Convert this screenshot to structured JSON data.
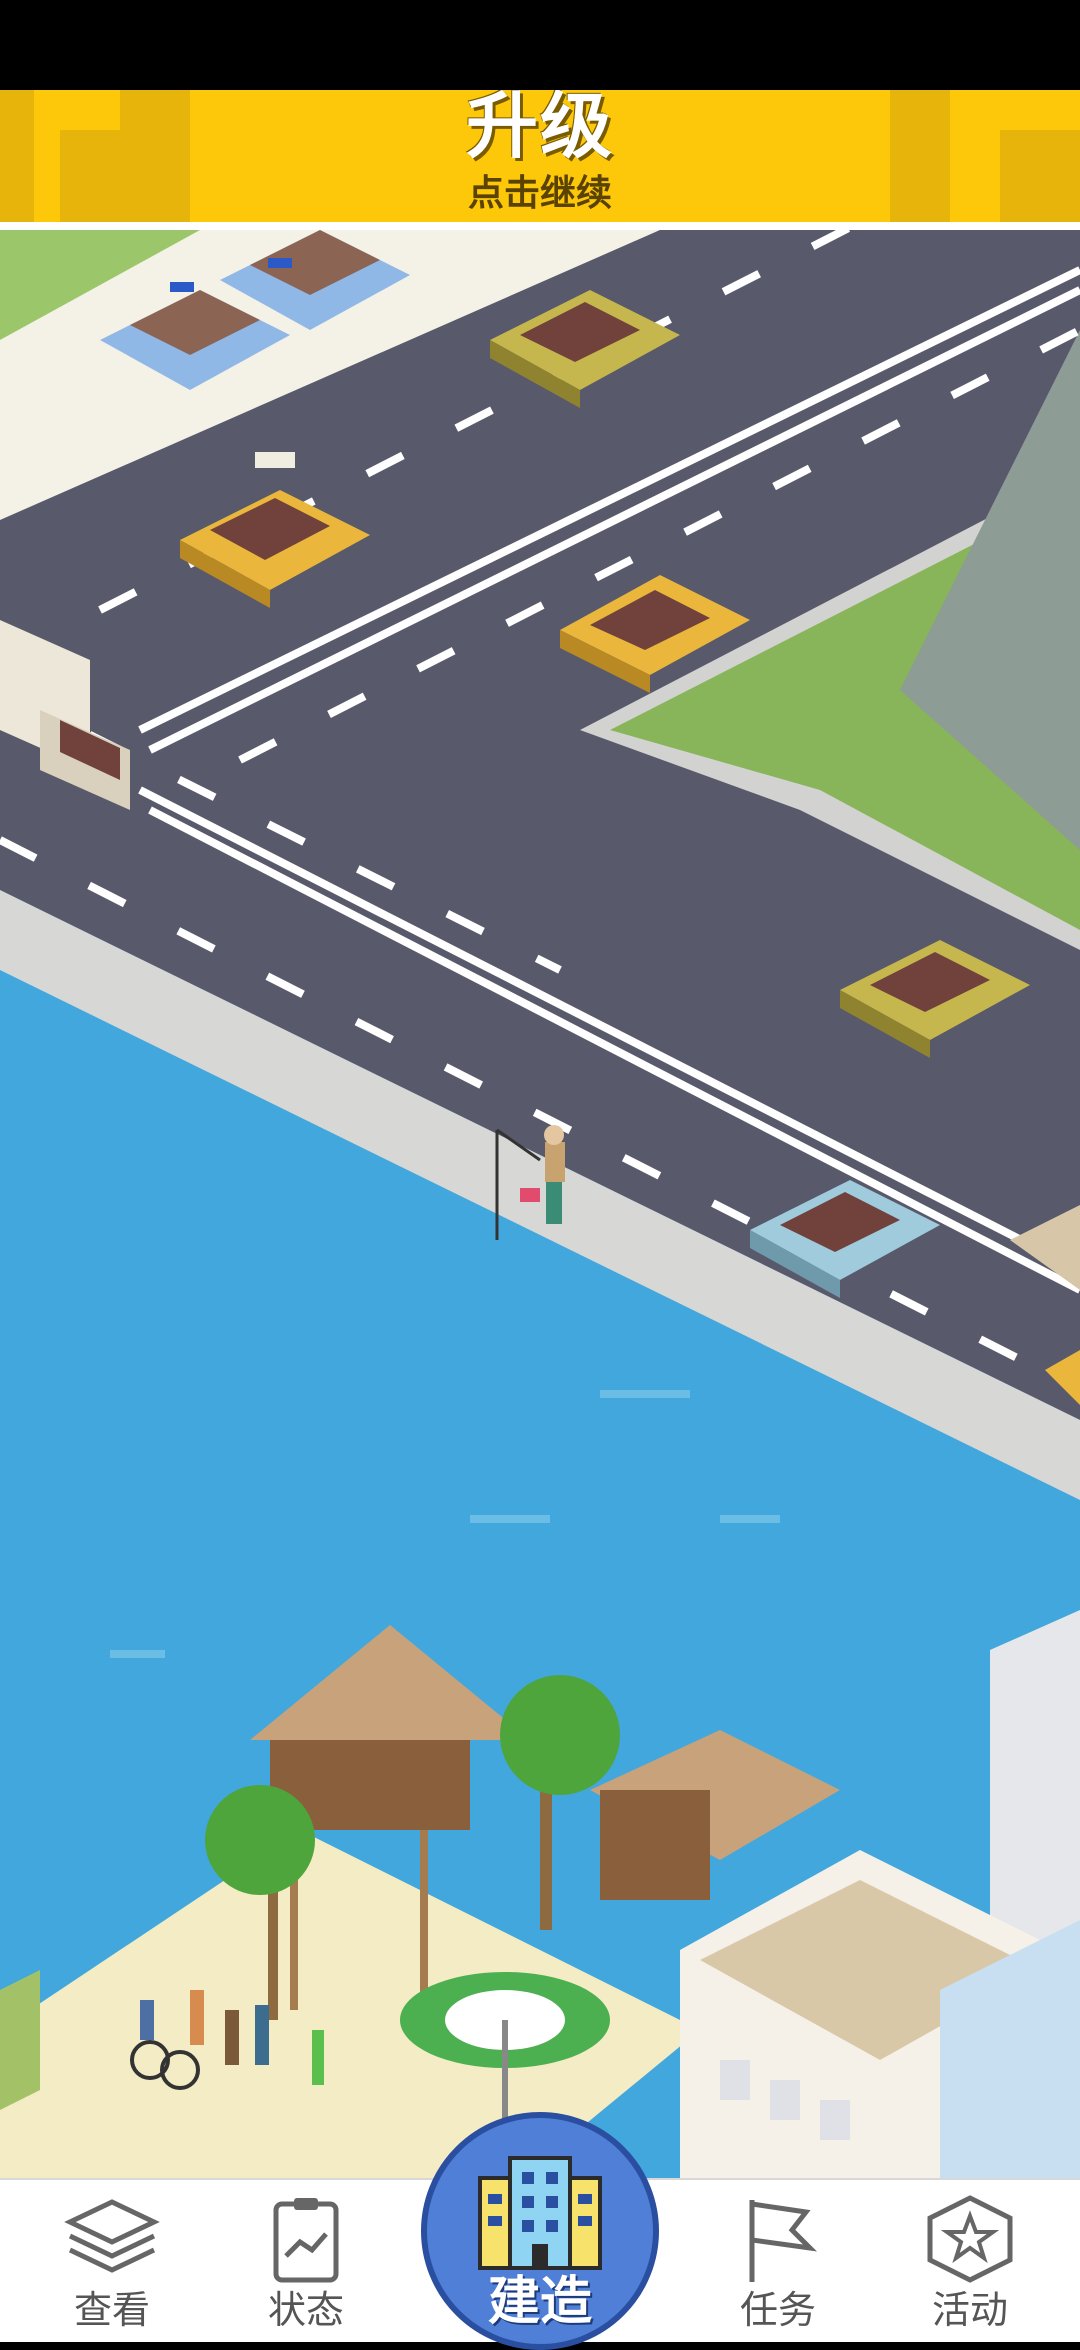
{
  "banner": {
    "title": "升级",
    "subtitle": "点击继续"
  },
  "nav": {
    "items": [
      {
        "label": "查看",
        "icon": "layers-icon"
      },
      {
        "label": "状态",
        "icon": "clipboard-chart-icon"
      },
      {
        "label": "任务",
        "icon": "flag-icon"
      },
      {
        "label": "活动",
        "icon": "star-hexagon-icon"
      }
    ],
    "build": {
      "label": "建造",
      "icon": "building-icon"
    }
  },
  "colors": {
    "banner": "#fdc70a",
    "water": "#42a7dc",
    "road": "#585a6c",
    "build_button": "#4f7fd6"
  }
}
